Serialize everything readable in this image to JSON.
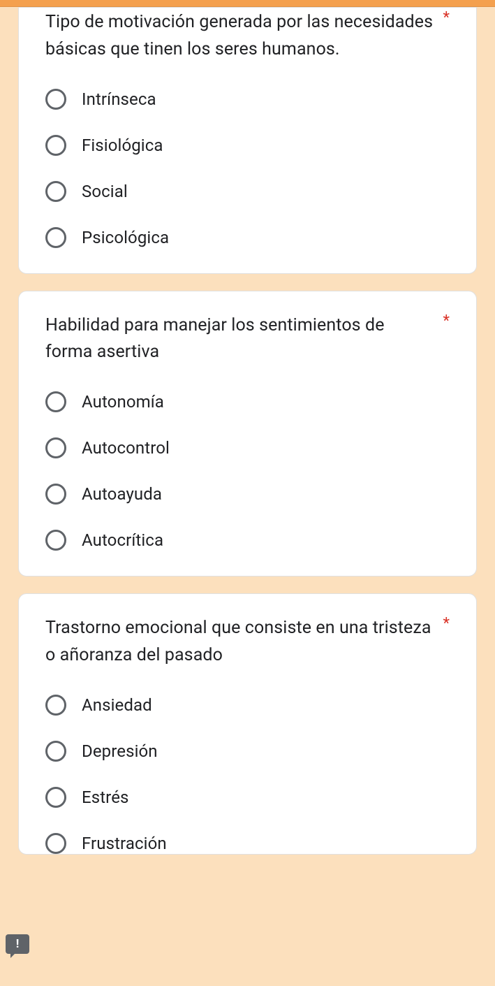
{
  "required_marker": "*",
  "feedback_icon": "!",
  "questions": [
    {
      "text": "Tipo de motivación generada por las necesidades básicas que tinen los seres humanos.",
      "options": [
        "Intrínseca",
        "Fisiológica",
        "Social",
        "Psicológica"
      ]
    },
    {
      "text": "Habilidad para manejar los sentimientos de forma asertiva",
      "options": [
        "Autonomía",
        "Autocontrol",
        "Autoayuda",
        "Autocrítica"
      ]
    },
    {
      "text": "Trastorno emocional que consiste en una tristeza o añoranza del pasado",
      "options": [
        "Ansiedad",
        "Depresión",
        "Estrés",
        "Frustración"
      ]
    }
  ]
}
